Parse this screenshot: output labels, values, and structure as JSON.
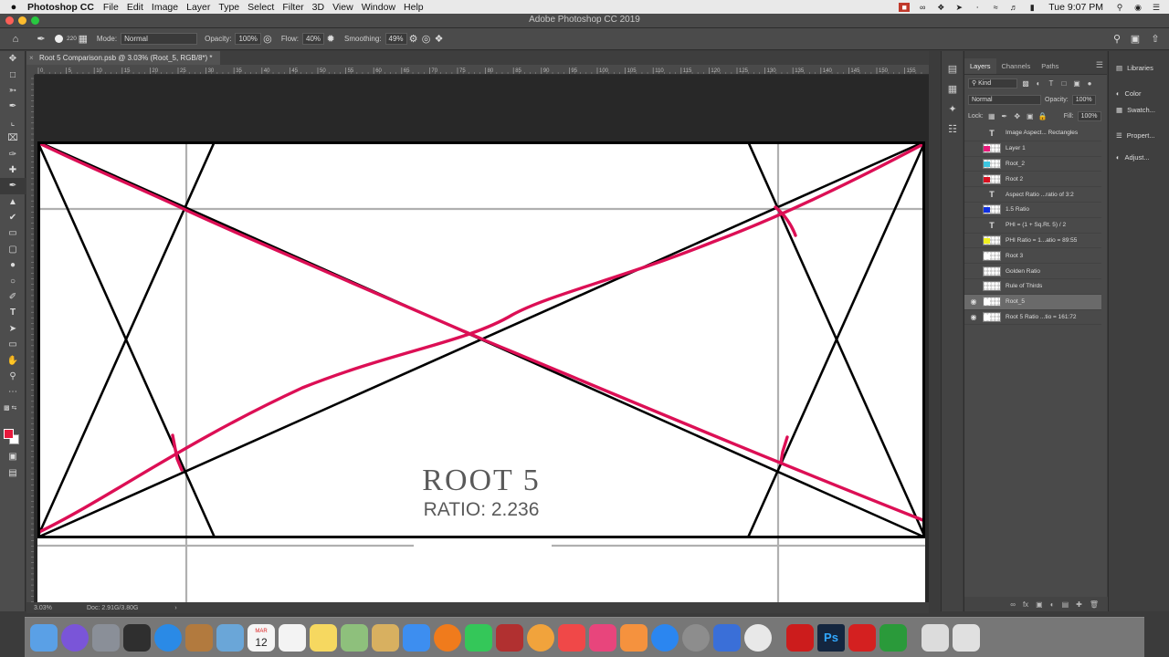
{
  "menubar": {
    "apple": "",
    "app_name": "Photoshop CC",
    "menus": [
      "File",
      "Edit",
      "Image",
      "Layer",
      "Type",
      "Select",
      "Filter",
      "3D",
      "View",
      "Window",
      "Help"
    ],
    "clock": "Tue 9:07 PM"
  },
  "window": {
    "title": "Adobe Photoshop CC 2019"
  },
  "options": {
    "brush_size": "220",
    "mode_label": "Mode:",
    "mode_value": "Normal",
    "opacity_label": "Opacity:",
    "opacity_value": "100%",
    "flow_label": "Flow:",
    "flow_value": "40%",
    "smoothing_label": "Smoothing:",
    "smoothing_value": "49%"
  },
  "document": {
    "tab_title": "Root 5 Comparison.psb @ 3.03% (Root_5, RGB/8*) *",
    "ruler_marks": [
      "0",
      "5",
      "10",
      "15",
      "20",
      "25",
      "30",
      "35",
      "40",
      "45",
      "50",
      "55",
      "60",
      "65",
      "70",
      "75",
      "80",
      "85",
      "90",
      "95",
      "100",
      "105",
      "110",
      "115",
      "120",
      "125",
      "130",
      "135",
      "140",
      "145",
      "150",
      "155",
      "160"
    ],
    "zoom": "3.03%",
    "doc_size": "Doc: 2.91G/3.80G",
    "heading": "ROOT 5",
    "subheading": "RATIO: 2.236"
  },
  "layers_panel": {
    "tabs": [
      "Layers",
      "Channels",
      "Paths"
    ],
    "filter_value": "Kind",
    "blend_mode": "Normal",
    "opacity_label": "Opacity:",
    "opacity_value": "100%",
    "lock_label": "Lock:",
    "fill_label": "Fill:",
    "fill_value": "100%",
    "layers": [
      {
        "name": "Image Aspect... Rectangles",
        "kind": "text",
        "visible": false,
        "selected": false,
        "swatch": ""
      },
      {
        "name": "Layer 1",
        "kind": "pixel",
        "visible": false,
        "selected": false,
        "swatch": "#e8197a"
      },
      {
        "name": "Root_2",
        "kind": "pixel",
        "visible": false,
        "selected": false,
        "swatch": "#3cc6e0"
      },
      {
        "name": "Root 2",
        "kind": "pixel",
        "visible": false,
        "selected": false,
        "swatch": "#d81020"
      },
      {
        "name": "Aspect Ratio ...ratio of 3:2",
        "kind": "text",
        "visible": false,
        "selected": false,
        "swatch": ""
      },
      {
        "name": "1.5 Ratio",
        "kind": "pixel",
        "visible": false,
        "selected": false,
        "swatch": "#1030e0"
      },
      {
        "name": "PHI = (1 + Sq.Rt. 5) / 2",
        "kind": "text",
        "visible": false,
        "selected": false,
        "swatch": ""
      },
      {
        "name": "PHI Ratio = 1...atio = 89:55",
        "kind": "pixel",
        "visible": false,
        "selected": false,
        "swatch": "#f0f020"
      },
      {
        "name": "Root 3",
        "kind": "pixel",
        "visible": false,
        "selected": false,
        "swatch": "#ffffff"
      },
      {
        "name": "Golden Ratio",
        "kind": "pixel",
        "visible": false,
        "selected": false,
        "swatch": ""
      },
      {
        "name": "Rule of Thirds",
        "kind": "pixel",
        "visible": false,
        "selected": false,
        "swatch": ""
      },
      {
        "name": "Root_5",
        "kind": "pixel",
        "visible": true,
        "selected": true,
        "swatch": "#ffffff"
      },
      {
        "name": "Root 5 Ratio ...tio = 161:72",
        "kind": "pixel",
        "visible": true,
        "selected": false,
        "swatch": "#ffffff"
      }
    ]
  },
  "right_panels": {
    "libraries": "Libraries",
    "color": "Color",
    "swatches": "Swatch...",
    "properties": "Propert...",
    "adjustments": "Adjust..."
  },
  "colors": {
    "foreground": "#e8193c",
    "background": "#ffffff",
    "stroke_overlay": "#dc0f55"
  },
  "dock": {
    "icons": [
      "finder-icon",
      "siri-icon",
      "launchpad-icon",
      "activity-icon",
      "safari-icon",
      "books-folder-icon",
      "preview-icon",
      "calendar-icon",
      "reminders-icon",
      "notes-icon",
      "maps-icon",
      "photos-folder-icon",
      "messages-icon",
      "firefox-icon",
      "facetime-icon",
      "photobooth-icon",
      "photos-icon",
      "news-icon",
      "itunes-icon",
      "ibooks-icon",
      "appstore-icon",
      "sysprefs-icon",
      "keynote-icon",
      "chrome-icon",
      "acrobat-icon",
      "photoshop-icon",
      "acrobat-reader-icon",
      "camtasia-icon",
      "downloads-stack-icon",
      "trash-icon"
    ],
    "calendar_day": "12",
    "calendar_month": "MAR"
  }
}
